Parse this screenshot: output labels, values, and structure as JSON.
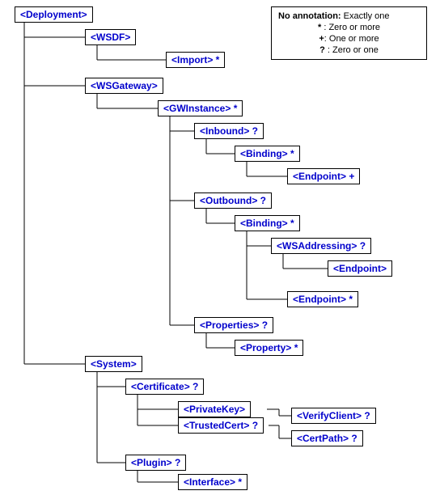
{
  "legend": {
    "title": "No annotation:",
    "title_desc": "Exactly one",
    "rows": [
      {
        "sym": "*",
        "desc": "Zero or more"
      },
      {
        "sym": "+",
        "desc": "One or more"
      },
      {
        "sym": "?",
        "desc": "Zero or one"
      }
    ]
  },
  "nodes": {
    "deployment": "<Deployment>",
    "wsdf": "<WSDF>",
    "import": "<Import> *",
    "wsgateway": "<WSGateway>",
    "gwinstance": "<GWInstance> *",
    "inbound": "<Inbound> ?",
    "binding_in": "<Binding> *",
    "endpoint_in": "<Endpoint> +",
    "outbound": "<Outbound> ?",
    "binding_out": "<Binding> *",
    "wsaddressing": "<WSAddressing> ?",
    "endpoint_wsa": "<Endpoint>",
    "endpoint_out": "<Endpoint> *",
    "properties": "<Properties> ?",
    "property": "<Property> *",
    "system": "<System>",
    "certificate": "<Certificate> ?",
    "privatekey": "<PrivateKey>",
    "trustedcert": "<TrustedCert> ?",
    "verifyclient": "<VerifyClient> ?",
    "certpath": "<CertPath> ?",
    "plugin": "<Plugin> ?",
    "interface": "<Interface> *"
  }
}
